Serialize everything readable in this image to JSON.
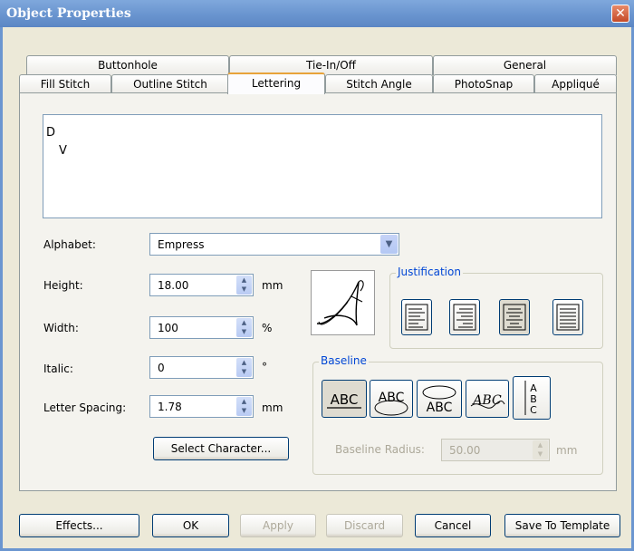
{
  "window": {
    "title": "Object Properties",
    "close_glyph": "✕"
  },
  "tabs_back": [
    "Buttonhole",
    "Tie-In/Off",
    "General"
  ],
  "tabs_front": [
    "Fill Stitch",
    "Outline Stitch",
    "Lettering",
    "Stitch Angle",
    "PhotoSnap",
    "Appliqué"
  ],
  "active_tab": "Lettering",
  "text_area": {
    "line1": "D",
    "line2": "V"
  },
  "alphabet": {
    "label": "Alphabet:",
    "value": "Empress"
  },
  "height": {
    "label": "Height:",
    "value": "18.00",
    "unit": "mm"
  },
  "width": {
    "label": "Width:",
    "value": "100",
    "unit": "%"
  },
  "italic": {
    "label": "Italic:",
    "value": "0",
    "unit": "°"
  },
  "letter_spacing": {
    "label": "Letter Spacing:",
    "value": "1.78",
    "unit": "mm"
  },
  "select_character_label": "Select Character...",
  "justification": {
    "label": "Justification",
    "options": [
      "align-left-icon",
      "align-right-icon",
      "align-center-icon",
      "align-full-icon"
    ],
    "selected": "align-center-icon"
  },
  "baseline": {
    "label": "Baseline",
    "options": [
      "baseline-straight",
      "baseline-arc-top",
      "baseline-circle",
      "baseline-wave",
      "baseline-vertical"
    ],
    "selected": "baseline-straight",
    "glyph_text": "ABC",
    "radius_label": "Baseline Radius:",
    "radius_value": "50.00",
    "radius_unit": "mm"
  },
  "footer": {
    "effects": "Effects...",
    "ok": "OK",
    "apply": "Apply",
    "discard": "Discard",
    "cancel": "Cancel",
    "save_template": "Save To Template"
  },
  "colors": {
    "title_bar": "#6b96d0",
    "dialog_bg": "#ece9d8",
    "active_tab_accent": "#e8a33a",
    "group_label": "#0046d5"
  }
}
